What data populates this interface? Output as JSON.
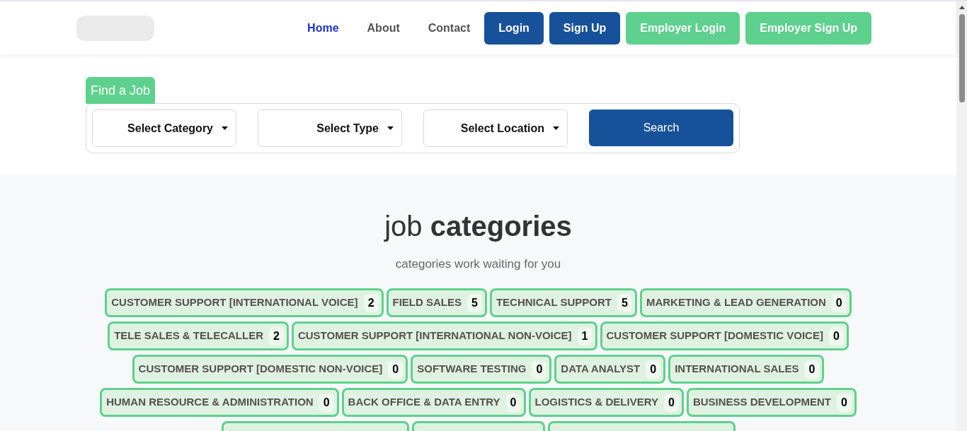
{
  "nav": {
    "links": [
      {
        "label": "Home",
        "selected": true
      },
      {
        "label": "About",
        "selected": false
      },
      {
        "label": "Contact",
        "selected": false
      }
    ],
    "buttons": [
      {
        "label": "Login",
        "kind": "primary"
      },
      {
        "label": "Sign Up",
        "kind": "primary"
      },
      {
        "label": "Employer Login",
        "kind": "employer"
      },
      {
        "label": "Employer Sign Up",
        "kind": "employer"
      }
    ]
  },
  "search": {
    "tab": "Find a Job",
    "selects": [
      {
        "label": "Select Category"
      },
      {
        "label": "Select Type"
      },
      {
        "label": "Select Location"
      }
    ],
    "button": "Search"
  },
  "categories": {
    "title": "job **categories**",
    "subtitle": "categories work waiting for you",
    "rows": [
      [
        {
          "label": "CUSTOMER SUPPORT [INTERNATIONAL VOICE]",
          "count": "2"
        },
        {
          "label": "FIELD SALES",
          "count": "5"
        },
        {
          "label": "TECHNICAL SUPPORT",
          "count": "5"
        },
        {
          "label": "MARKETING & LEAD GENERATION",
          "count": "0"
        }
      ],
      [
        {
          "label": "TELE SALES & TELECALLER",
          "count": "2"
        },
        {
          "label": "CUSTOMER SUPPORT [INTERNATIONAL NON-VOICE]",
          "count": "1"
        },
        {
          "label": "CUSTOMER SUPPORT [DOMESTIC VOICE]",
          "count": "0"
        }
      ],
      [
        {
          "label": "CUSTOMER SUPPORT [DOMESTIC NON-VOICE]",
          "count": "0"
        },
        {
          "label": "SOFTWARE TESTING",
          "count": "0"
        },
        {
          "label": "DATA ANALYST",
          "count": "0"
        },
        {
          "label": "INTERNATIONAL SALES",
          "count": "0"
        }
      ],
      [
        {
          "label": "HUMAN RESOURCE & ADMINISTRATION",
          "count": "0"
        },
        {
          "label": "BACK OFFICE & DATA ENTRY",
          "count": "0"
        },
        {
          "label": "LOGISTICS & DELIVERY",
          "count": "0"
        },
        {
          "label": "BUSINESS DEVELOPMENT",
          "count": "0"
        }
      ]
    ],
    "clipped_row": [
      {
        "kind": "clipped"
      },
      {
        "kind": "clipped"
      },
      {
        "kind": "clipped"
      }
    ]
  }
}
